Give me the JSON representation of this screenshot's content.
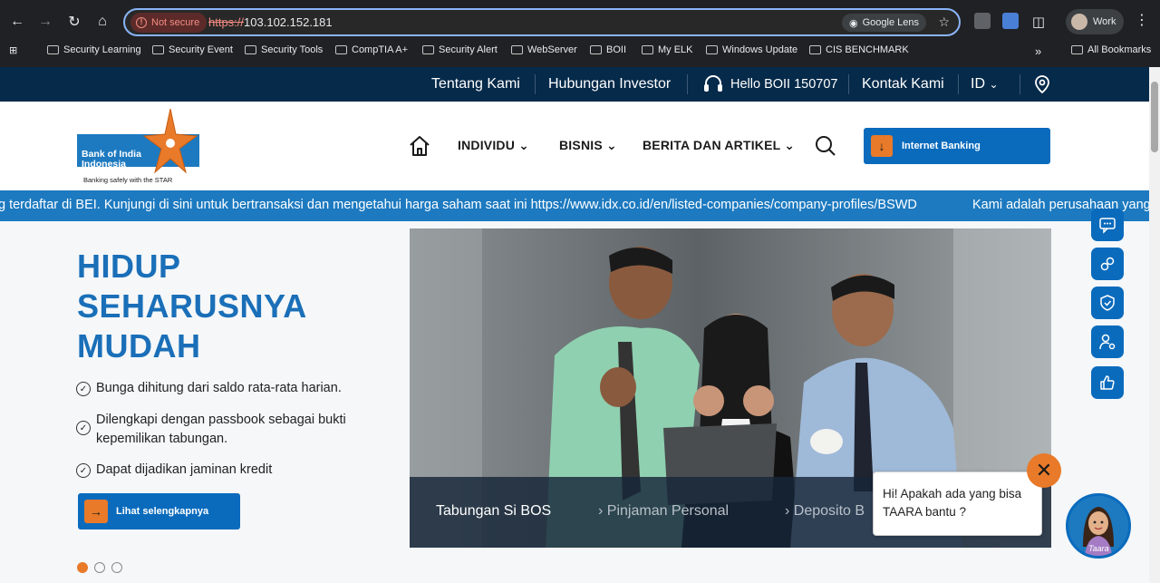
{
  "browser": {
    "security_label": "Not secure",
    "url_protocol": "https://",
    "url_host": "103.102.152.181",
    "lens_label": "Google Lens",
    "profile_label": "Work",
    "bookmarks": [
      "Security Learning",
      "Security Event",
      "Security Tools",
      "CompTIA A+",
      "Security Alert",
      "WebServer",
      "BOII",
      "My ELK",
      "Windows Update",
      "CIS BENCHMARK"
    ],
    "all_bookmarks": "All Bookmarks"
  },
  "topbar": {
    "about": "Tentang Kami",
    "investor": "Hubungan Investor",
    "hotline": "Hello BOII 150707",
    "contact": "Kontak Kami",
    "language": "ID"
  },
  "logo": {
    "name_line1": "Bank of India",
    "name_line2": "Indonesia",
    "tagline": "Banking safely with the STAR"
  },
  "nav": {
    "individual": "INDIVIDU",
    "business": "BISNIS",
    "news": "BERITA DAN ARTIKEL",
    "internet_banking": "Internet Banking"
  },
  "ticker": {
    "text1": "g terdaftar di BEI. Kunjungi di sini untuk bertransaksi dan mengetahui harga saham saat ini https://www.idx.co.id/en/listed-companies/company-profiles/BSWD",
    "text2": "Kami adalah perusahaan yang"
  },
  "hero": {
    "title_lines": [
      "HIDUP",
      "SEHARUSNYA",
      "MUDAH"
    ],
    "bullets": [
      "Bunga dihitung dari saldo rata-rata harian.",
      "Dilengkapi dengan passbook sebagai bukti kepemilikan tabungan.",
      "Dapat dijadikan jaminan kredit"
    ],
    "cta": "Lihat selengkapnya"
  },
  "photo_tabs": [
    "Tabungan Si BOS",
    "Pinjaman Personal",
    "Deposito B"
  ],
  "chat": {
    "message": "Hi! Apakah ada yang bisa TAARA bantu ?",
    "avatar_label": "Taara"
  },
  "colors": {
    "brand_blue": "#0a6bbd",
    "dark_navy": "#052a4a",
    "accent_orange": "#e87a2a",
    "ticker_blue": "#1d7ac0"
  }
}
